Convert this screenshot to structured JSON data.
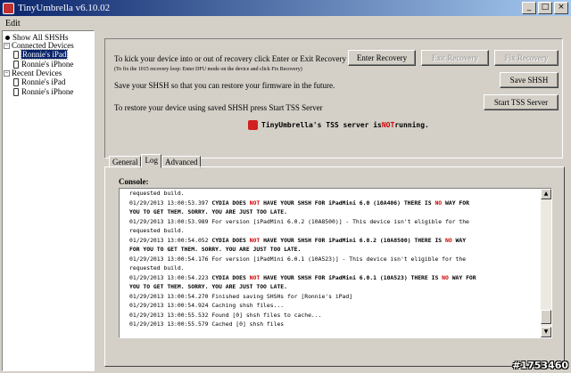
{
  "window": {
    "title": "TinyUmbrella v6.10.02",
    "icon": "umbrella-app-icon",
    "controls": [
      "_",
      "□",
      "×"
    ]
  },
  "menu": {
    "edit": "Edit"
  },
  "tree": {
    "show_all": "Show All SHSHs",
    "connected_header": "Connected Devices",
    "connected": [
      "Ronnie's iPad",
      "Ronnie's iPhone"
    ],
    "recent_header": "Recent Devices",
    "recent": [
      "Ronnie's iPad",
      "Ronnie's iPhone"
    ],
    "toggle": "−"
  },
  "controls": {
    "recovery_text": "To kick your device into or out of recovery click Enter or Exit Recovery",
    "recovery_hint": "(To fix the 1015 recovery loop: Enter DFU mode on the device and click Fix Recovery)",
    "save_text": "Save your SHSH so that you can restore your firmware in the future.",
    "restore_text": "To restore your device using saved SHSH press Start TSS Server",
    "enter_recovery": "Enter Recovery",
    "exit_recovery": "Exit Recovery",
    "fix_recovery": "Fix Recovery",
    "save_shsh": "Save SHSH",
    "start_tss": "Start TSS Server",
    "tss_status_prefix": "TinyUmbrella's TSS server is ",
    "tss_status_not": "NOT",
    "tss_status_suffix": " running."
  },
  "tabs": [
    "General",
    "Log",
    "Advanced"
  ],
  "console": {
    "label": "Console:",
    "lines": [
      [
        {
          "t": "requested build.",
          "s": "n"
        }
      ],
      [
        {
          "t": "01/29/2013 13:00:53.397 ",
          "s": "n"
        },
        {
          "t": "CYDIA DOES ",
          "s": "b"
        },
        {
          "t": "NOT",
          "s": "r"
        },
        {
          "t": " HAVE YOUR SHSH FOR iPadMini 6.0 (10A406) THERE IS ",
          "s": "b"
        },
        {
          "t": "NO",
          "s": "r"
        },
        {
          "t": " WAY FOR",
          "s": "b"
        }
      ],
      [
        {
          "t": "YOU TO GET THEM. SORRY. YOU ARE JUST TOO LATE.",
          "s": "b"
        }
      ],
      [
        {
          "t": "01/29/2013 13:00:53.989 For version [iPadMini 6.0.2 (10A8500)] - This device isn't eligible for the",
          "s": "n"
        }
      ],
      [
        {
          "t": "requested build.",
          "s": "n"
        }
      ],
      [
        {
          "t": "01/29/2013 13:00:54.052 ",
          "s": "n"
        },
        {
          "t": "CYDIA DOES ",
          "s": "b"
        },
        {
          "t": "NOT",
          "s": "r"
        },
        {
          "t": " HAVE YOUR SHSH FOR iPadMini 6.0.2 (10A8500) THERE IS ",
          "s": "b"
        },
        {
          "t": "NO",
          "s": "r"
        },
        {
          "t": " WAY",
          "s": "b"
        }
      ],
      [
        {
          "t": "FOR YOU TO GET THEM. SORRY. YOU ARE JUST TOO LATE.",
          "s": "b"
        }
      ],
      [
        {
          "t": "01/29/2013 13:00:54.176 For version [iPadMini 6.0.1 (10A523)] - This device isn't eligible for the",
          "s": "n"
        }
      ],
      [
        {
          "t": "requested build.",
          "s": "n"
        }
      ],
      [
        {
          "t": "01/29/2013 13:00:54.223 ",
          "s": "n"
        },
        {
          "t": "CYDIA DOES ",
          "s": "b"
        },
        {
          "t": "NOT",
          "s": "r"
        },
        {
          "t": " HAVE YOUR SHSH FOR iPadMini 6.0.1 (10A523) THERE IS ",
          "s": "b"
        },
        {
          "t": "NO",
          "s": "r"
        },
        {
          "t": " WAY FOR",
          "s": "b"
        }
      ],
      [
        {
          "t": "YOU TO GET THEM. SORRY. YOU ARE JUST TOO LATE.",
          "s": "b"
        }
      ],
      [
        {
          "t": "01/29/2013 13:00:54.270 Finished saving SHSHs for [Ronnie's iPad]",
          "s": "n"
        }
      ],
      [
        {
          "t": "01/29/2013 13:00:54.924 Caching shsh files...",
          "s": "n"
        }
      ],
      [
        {
          "t": "01/29/2013 13:00:55.532 Found [0] shsh files to cache...",
          "s": "n"
        }
      ],
      [
        {
          "t": "01/29/2013 13:00:55.579 Cached [0] shsh files",
          "s": "n"
        }
      ]
    ],
    "scroll_up": "▲",
    "scroll_down": "▼"
  },
  "watermark": "#1753460",
  "colors": {
    "title_start": "#0a246a",
    "title_end": "#a6caf0",
    "alert_red": "#d00000",
    "face": "#d4d0c8"
  }
}
